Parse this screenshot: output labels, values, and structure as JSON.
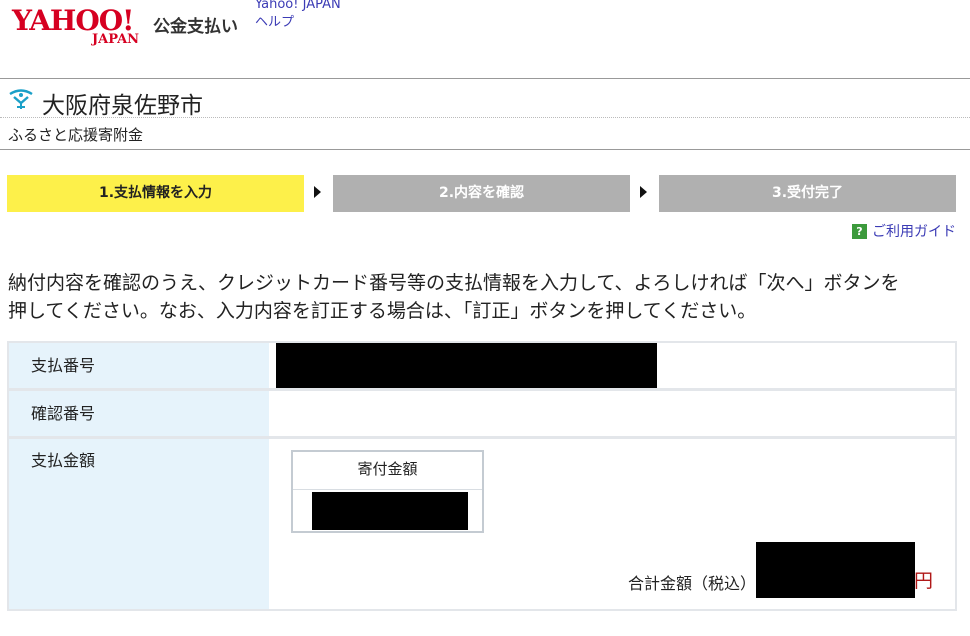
{
  "header": {
    "logo_text": "YAHOO!",
    "logo_sub": "JAPAN",
    "service_name": "公金支払い",
    "links": [
      "Yahoo! JAPAN",
      "ヘルプ"
    ]
  },
  "recipient": {
    "city": "大阪府泉佐野市",
    "category": "ふるさと応援寄附金"
  },
  "steps": [
    {
      "label": "1.支払情報を入力",
      "state": "active"
    },
    {
      "label": "2.内容を確認",
      "state": "inactive"
    },
    {
      "label": "3.受付完了",
      "state": "inactive"
    }
  ],
  "guide_link": "ご利用ガイド",
  "instruction_line1": "納付内容を確認のうえ、クレジットカード番号等の支払情報を入力して、よろしければ「次へ」ボタンを",
  "instruction_line2": "押してください。なお、入力内容を訂正する場合は、「訂正」ボタンを押してください。",
  "table": {
    "payment_number_label": "支払番号",
    "confirmation_number_label": "確認番号",
    "amount_label": "支払金額",
    "donation_amount_header": "寄付金額",
    "total_label": "合計金額（税込）",
    "currency": "円"
  },
  "colors": {
    "brand_red": "#d60021",
    "step_active": "#fdf04a",
    "step_inactive": "#b0b0b0",
    "label_bg": "#e6f3fb",
    "link": "#3b3bb5"
  }
}
